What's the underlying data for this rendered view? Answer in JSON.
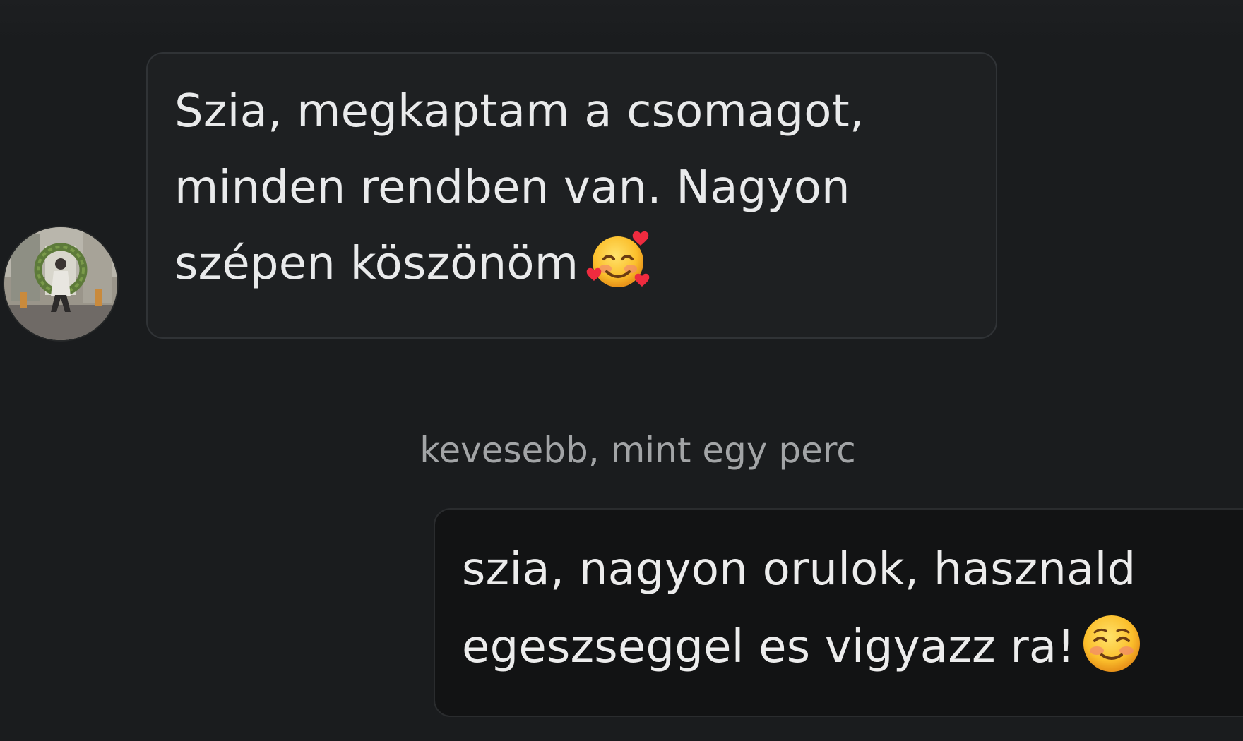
{
  "conversation": {
    "incoming": {
      "text": "Szia, megkaptam a csomagot,\nminden rendben van. Nagyon\nszépen köszönöm",
      "emoji": "smiling-face-with-hearts-icon"
    },
    "timestamp": "kevesebb, mint egy perc",
    "outgoing": {
      "text": "szia, nagyon orulok, hasznald\negeszseggel es vigyazz ra!",
      "emoji": "smiling-face-icon"
    }
  },
  "colors": {
    "background": "#1a1c1e",
    "incoming_bubble": "#1e2022",
    "outgoing_bubble": "#121314",
    "text": "#e9eaeb",
    "timestamp": "#a2a4a6"
  }
}
